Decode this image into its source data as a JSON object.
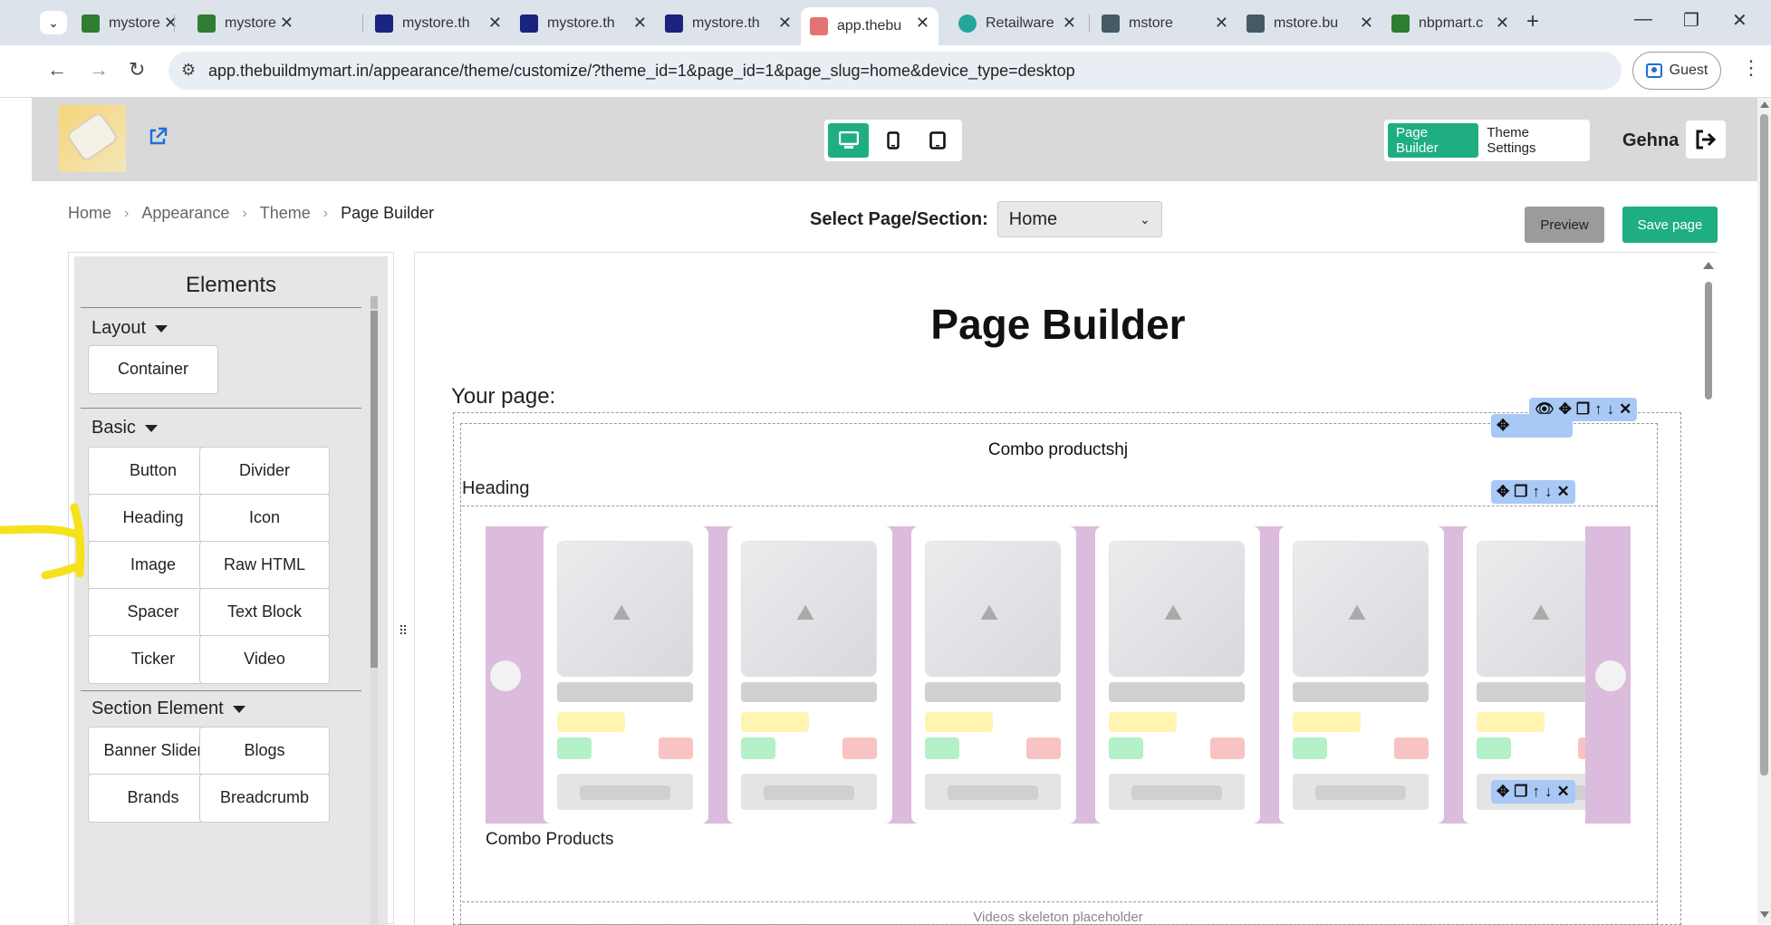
{
  "browser": {
    "tabs": [
      {
        "title": "mystore",
        "favicon": "#2e7d32"
      },
      {
        "title": "mystore",
        "favicon": "#2e7d32"
      },
      {
        "title": "mystore.th",
        "favicon": "#1a237e"
      },
      {
        "title": "mystore.th",
        "favicon": "#1a237e"
      },
      {
        "title": "mystore.th",
        "favicon": "#1a237e"
      },
      {
        "title": "app.thebu",
        "favicon": "#e57373",
        "active": true
      },
      {
        "title": "Retailware",
        "favicon": "#26a69a"
      },
      {
        "title": "mstore",
        "favicon": "#455a64"
      },
      {
        "title": "mstore.bu",
        "favicon": "#455a64"
      },
      {
        "title": "nbpmart.c",
        "favicon": "#2e7d32"
      }
    ],
    "new_tab": "+",
    "close_glyph": "✕",
    "url": "app.thebuildmymart.in/appearance/theme/customize/?theme_id=1&page_id=1&page_slug=home&device_type=desktop",
    "profile_label": "Guest"
  },
  "header": {
    "device_buttons": [
      "desktop",
      "mobile",
      "tablet"
    ],
    "active_device": "desktop",
    "modes": [
      "Page Builder",
      "Theme Settings"
    ],
    "active_mode": "Page Builder",
    "user_name": "Gehna",
    "accent_color": "#1fae82"
  },
  "breadcrumb": [
    "Home",
    "Appearance",
    "Theme",
    "Page Builder"
  ],
  "page_select": {
    "label": "Select Page/Section:",
    "value": "Home"
  },
  "actions": {
    "preview": "Preview",
    "save": "Save page"
  },
  "elements_panel": {
    "title": "Elements",
    "groups": {
      "layout": {
        "label": "Layout",
        "items": [
          "Container"
        ]
      },
      "basic": {
        "label": "Basic",
        "items": [
          "Button",
          "Divider",
          "Heading",
          "Icon",
          "Image",
          "Raw HTML",
          "Spacer",
          "Text Block",
          "Ticker",
          "Video"
        ]
      },
      "section": {
        "label": "Section Element",
        "items": [
          "Banner Slider",
          "Blogs",
          "Brands",
          "Breadcrumb"
        ]
      }
    }
  },
  "canvas": {
    "title": "Page Builder",
    "your_page": "Your page:",
    "combo_title": "Combo productshj",
    "heading_label": "Heading",
    "combo_products_label": "Combo Products",
    "videos_placeholder": "Videos skeleton placeholder",
    "carousel_color": "#dbbcdc",
    "card_count": 6
  }
}
